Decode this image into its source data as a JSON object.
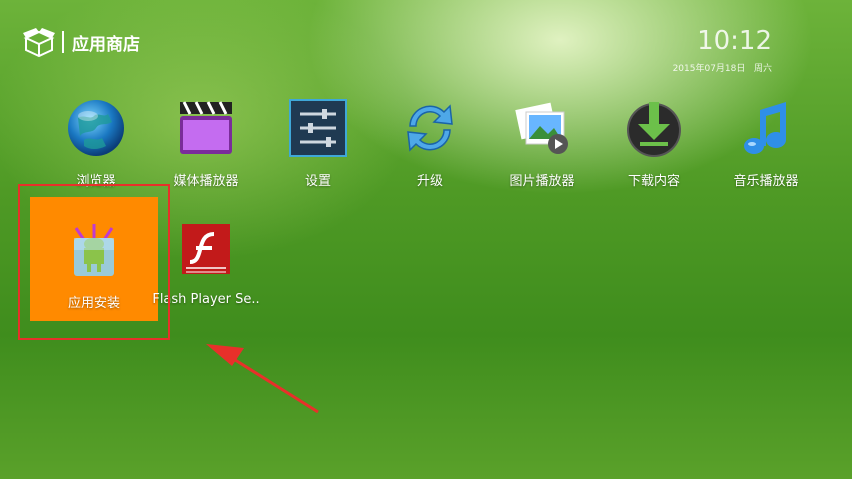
{
  "header": {
    "title": "应用商店",
    "time": "10:12",
    "date": "2015年07月18日",
    "weekday": "周六"
  },
  "apps_row1": [
    {
      "label": "浏览器",
      "icon": "globe-icon"
    },
    {
      "label": "媒体播放器",
      "icon": "clapperboard-icon"
    },
    {
      "label": "设置",
      "icon": "settings-sliders-icon"
    },
    {
      "label": "升级",
      "icon": "refresh-icon"
    },
    {
      "label": "图片播放器",
      "icon": "photo-viewer-icon"
    },
    {
      "label": "下载内容",
      "icon": "download-icon"
    },
    {
      "label": "音乐播放器",
      "icon": "music-note-icon"
    }
  ],
  "apps_row2": [
    {
      "label": "应用安装",
      "icon": "android-package-icon"
    },
    {
      "label": "Flash Player Se..",
      "icon": "flash-icon"
    }
  ],
  "colors": {
    "accent": "#ff8a00",
    "highlight_border": "#e8302a",
    "arrow": "#e8302a"
  }
}
